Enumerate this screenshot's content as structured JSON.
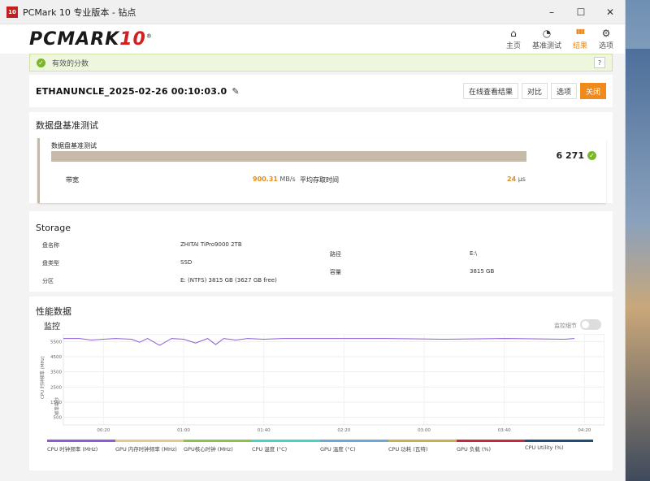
{
  "window": {
    "title": "PCMark 10 专业版本 - 钻点",
    "icon_text": "10",
    "min": "–",
    "max": "☐",
    "close": "✕"
  },
  "header": {
    "logo": "PCMARK",
    "logo_num": "10",
    "logo_reg": "®",
    "nav": [
      {
        "label": "主页",
        "icon": "home-icon",
        "glyph": "⌂"
      },
      {
        "label": "基准测试",
        "icon": "gauge-icon",
        "glyph": "◔"
      },
      {
        "label": "结果",
        "icon": "bars-icon",
        "glyph": "▮▮▮",
        "active": true
      },
      {
        "label": "选项",
        "icon": "gear-icon",
        "glyph": "⚙"
      }
    ]
  },
  "banner": {
    "text": "有效的分数",
    "help": "?"
  },
  "result": {
    "title": "ETHANUNCLE_2025-02-26 00:10:03.0",
    "buttons": {
      "online": "在线查看结果",
      "compare": "对比",
      "options": "选项",
      "close": "关闭"
    }
  },
  "benchmark": {
    "section_title": "数据盘基准测试",
    "test_name": "数据盘基准测试",
    "score": "6 271",
    "bandwidth_label": "带宽",
    "bandwidth_value": "900.31",
    "bandwidth_unit": "MB/s",
    "latency_label": "平均存取时间",
    "latency_value": "24",
    "latency_unit": "μs"
  },
  "storage": {
    "section_title": "Storage",
    "rows": {
      "name_label": "盘名称",
      "name_value": "ZHITAI TiPro9000 2TB",
      "type_label": "盘类型",
      "type_value": "SSD",
      "partition_label": "分区",
      "partition_value": "E: (NTFS) 3815 GB (3627 GB free)",
      "path_label": "路径",
      "path_value": "E:\\",
      "capacity_label": "容量",
      "capacity_value": "3815 GB"
    }
  },
  "performance": {
    "section_title": "性能数据",
    "monitor_title": "监控",
    "toggle_label": "监控细节",
    "legend": [
      {
        "label": "CPU 时钟频率 (MHz)",
        "color": "#8e5bd6"
      },
      {
        "label": "GPU 内存时钟频率 (MHz)",
        "color": "#e2c88f"
      },
      {
        "label": "GPU核心时钟 (MHz)",
        "color": "#8bc34a"
      },
      {
        "label": "CPU 温度 (°C)",
        "color": "#43d6c0"
      },
      {
        "label": "GPU 温度 (°C)",
        "color": "#6aa8d8"
      },
      {
        "label": "CPU 功耗 (瓦特)",
        "color": "#c9b04a"
      },
      {
        "label": "GPU 负载 (%)",
        "color": "#c8283c"
      },
      {
        "label": "CPU Utility (%)",
        "color": "#1f4d7a"
      }
    ]
  },
  "chart_data": {
    "type": "line",
    "ylabel": "CPU 时钟频率 (MHz)",
    "ylabel2": "帧率每秒",
    "y_ticks": [
      "5500",
      "4500",
      "3500",
      "2500",
      "1500",
      "500"
    ],
    "ylim": [
      0,
      6000
    ],
    "x_ticks": [
      "00:20",
      "01:00",
      "01:40",
      "02:20",
      "03:00",
      "03:40",
      "04:20"
    ],
    "xlim": [
      0,
      270
    ],
    "series": [
      {
        "name": "CPU 时钟频率 (MHz)",
        "x": [
          0,
          8,
          14,
          20,
          26,
          34,
          38,
          42,
          48,
          54,
          60,
          66,
          72,
          76,
          80,
          86,
          92,
          100,
          110,
          130,
          160,
          190,
          220,
          250,
          255
        ],
        "values": [
          5700,
          5700,
          5600,
          5650,
          5700,
          5650,
          5450,
          5700,
          5250,
          5700,
          5650,
          5400,
          5700,
          5300,
          5700,
          5600,
          5700,
          5650,
          5700,
          5700,
          5700,
          5650,
          5700,
          5650,
          5700
        ]
      }
    ]
  }
}
